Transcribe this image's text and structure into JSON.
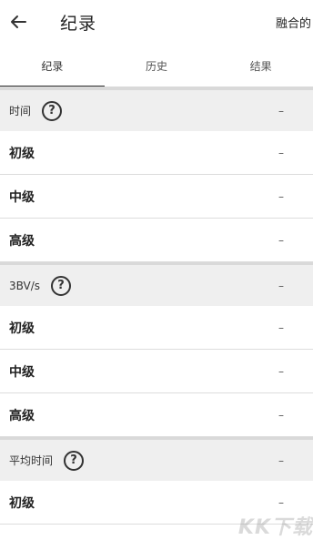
{
  "appbar": {
    "back_icon": "arrow-left-icon",
    "title": "纪录",
    "right_action": "融合的"
  },
  "tabs": [
    {
      "label": "纪录",
      "active": true
    },
    {
      "label": "历史",
      "active": false
    },
    {
      "label": "结果",
      "active": false
    }
  ],
  "sections": [
    {
      "label": "时间",
      "help_icon": "question-circle-icon",
      "value": "–",
      "rows": [
        {
          "label": "初级",
          "value": "–"
        },
        {
          "label": "中级",
          "value": "–"
        },
        {
          "label": "高级",
          "value": "–"
        }
      ]
    },
    {
      "label": "3BV/s",
      "help_icon": "question-circle-icon",
      "value": "–",
      "rows": [
        {
          "label": "初级",
          "value": "–"
        },
        {
          "label": "中级",
          "value": "–"
        },
        {
          "label": "高级",
          "value": "–"
        }
      ]
    },
    {
      "label": "平均时间",
      "help_icon": "question-circle-icon",
      "value": "–",
      "rows": [
        {
          "label": "初级",
          "value": "–"
        }
      ]
    }
  ],
  "watermark": "KK下载"
}
